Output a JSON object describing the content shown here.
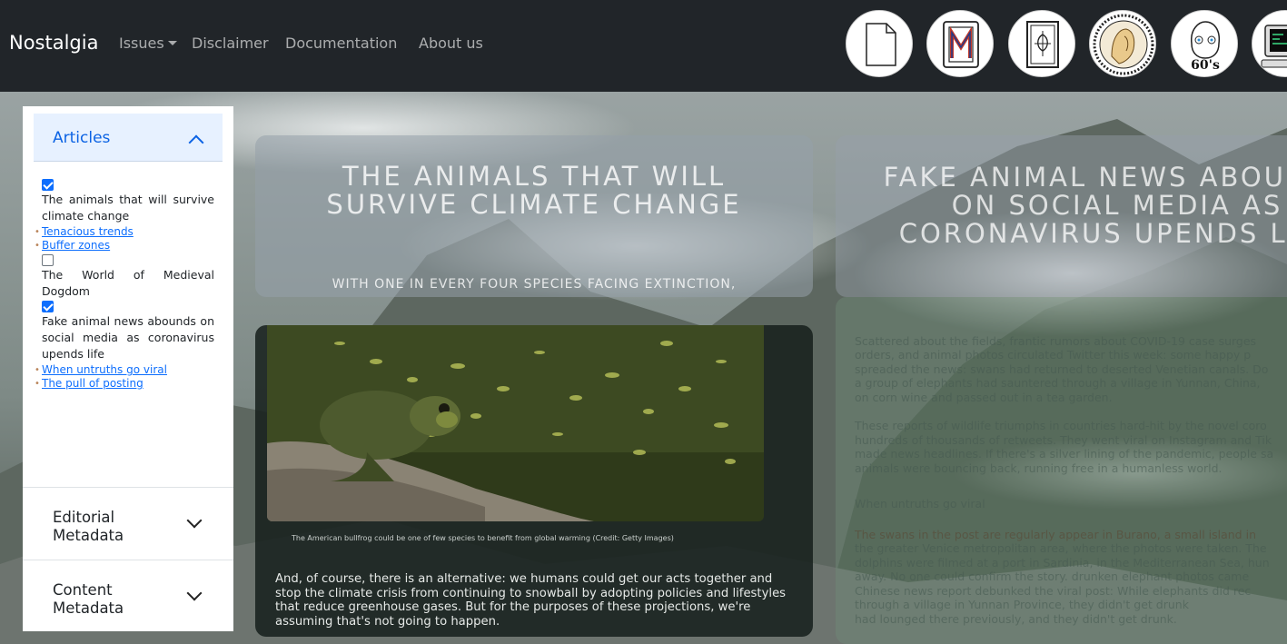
{
  "navbar": {
    "brand": "Nostalgia",
    "links": [
      "Issues",
      "Disclaimer",
      "Documentation",
      "About us"
    ],
    "issue_icons": [
      "blank-page-icon",
      "m-cabinet-icon",
      "ornamental-card-icon",
      "art-nouveau-portrait-icon",
      "sixties-face-icon",
      "retro-computer-icon"
    ],
    "sixties_text": "60's"
  },
  "sidebar": {
    "articles_header": "Articles",
    "articles": [
      {
        "checked": true,
        "title": "The animals that will survive climate change",
        "subs": [
          "Tenacious trends",
          "Buffer zones"
        ]
      },
      {
        "checked": false,
        "title": "The World of Medieval Dogdom",
        "subs": []
      },
      {
        "checked": true,
        "title": "Fake animal news abounds on social media as coronavirus upends life",
        "subs": [
          "When untruths go viral",
          "The pull of posting"
        ]
      }
    ],
    "editorial_metadata": "Editorial Metadata",
    "content_metadata": "Content Metadata"
  },
  "article1": {
    "title": "The animals that will survive climate change",
    "subtitle": "With one in every four species facing extinction,",
    "caption": "The American bullfrog could be one of few species to benefit from global warming (Credit: Getty Images)",
    "paragraph": "And, of course, there is an alternative: we humans could get our acts together and stop the climate crisis from continuing to snowball by adopting policies and lifestyles that reduce greenhouse gases. But for the purposes of these projections, we're assuming that's not going to happen."
  },
  "article2": {
    "title": "Fake animal news abounds on social media as coronavirus upends life",
    "faint_lines": [
      "Scattered about the fields, frantic rumors about COVID-19 case surges",
      "orders, and animal photos circulated Twitter this week: some happy p",
      "spreaded the news: swans had returned to deserted Venetian canals. Do",
      "a group of elephants had sauntered through a village in Yunnan, China,",
      "on corn wine and passed out in a tea garden.",
      "These reports of wildlife triumphs in countries hard-hit by the novel coro",
      "hundreds of thousands of retweets. They went viral on Instagram and Tik",
      "made news headlines. If there's a silver lining of the pandemic, people sa",
      "animals were bouncing back, running free in a humanless world.",
      "When untruths go viral",
      "The swans in the post are regularly appear in Burano, a small island in",
      "the greater Venice metropolitan area, where the photos were taken. The",
      "dolphins were filmed at a port in Sardinia, in the Mediterranean Sea, hun",
      "away. No one could confirm the story. drunken elephant photos came",
      "Chinese news report debunked the viral post: While elephants did rec",
      "through a village in Yunnan Province, they didn't get drunk",
      "had lounged there previously, and they didn't get drunk."
    ]
  }
}
